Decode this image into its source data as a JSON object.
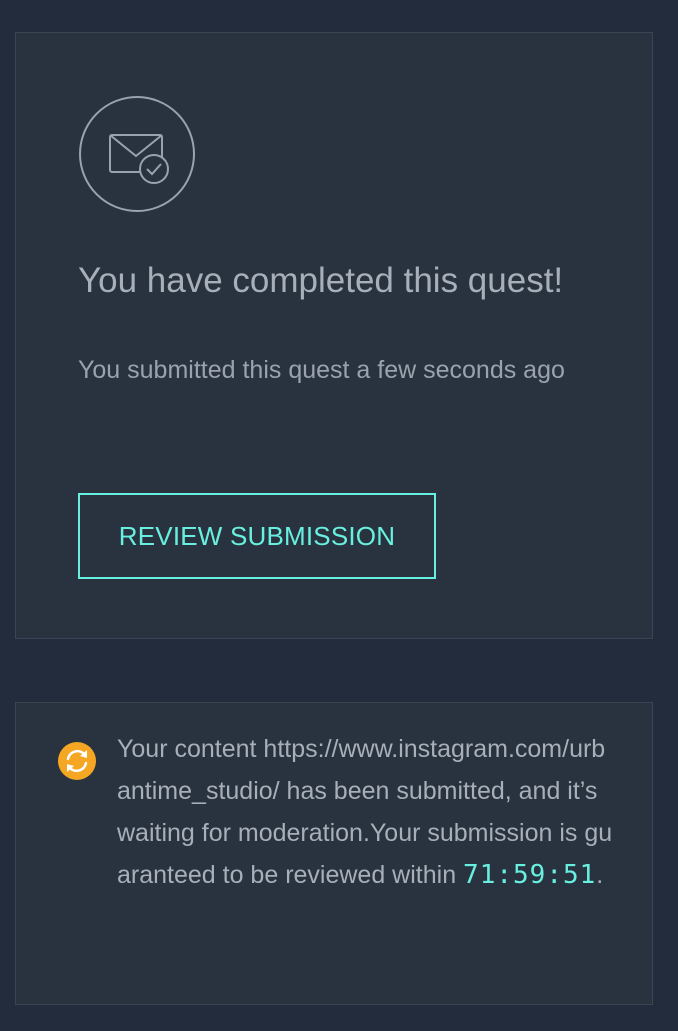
{
  "quest_complete": {
    "icon": "mail-check-icon",
    "title": "You have completed this quest!",
    "subtitle": "You submitted this quest a few seconds ago",
    "review_button_label": "REVIEW SUBMISSION"
  },
  "moderation_notice": {
    "icon": "sync-icon",
    "text_before_url": "Your content ",
    "url": "https://www.instagram.com/urbantime_studio/",
    "text_after_url": " has been submitted, and it’s waiting for moderation.Your submission is guaranteed to be reviewed within ",
    "countdown": "71:59:51",
    "text_end": "."
  },
  "colors": {
    "background": "#222c3c",
    "card": "#28333f",
    "accent": "#69efe0",
    "pending": "#f5a623"
  }
}
